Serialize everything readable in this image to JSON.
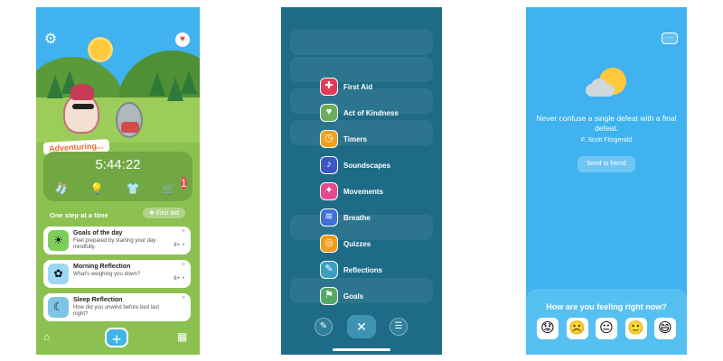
{
  "screen1": {
    "adventuring_label": "Adventuring...",
    "timer": "5:44:22",
    "cart_count": "1",
    "section_title": "One step at a time",
    "first_aid_label": "First aid",
    "cards": [
      {
        "title": "Goals of the day",
        "desc": "Feel prepared by starting your day mindfully.",
        "points": "8+ ⚡",
        "icon": "sun-icon"
      },
      {
        "title": "Morning Reflection",
        "desc": "What's weighing you down?",
        "points": "6+ ⚡",
        "icon": "flower-icon"
      },
      {
        "title": "Sleep Reflection",
        "desc": "How did you unwind before bed last night?",
        "points": "",
        "icon": "sleep-face-icon"
      }
    ],
    "close_glyph": "×",
    "plus_glyph": "+"
  },
  "screen2": {
    "menu": [
      {
        "label": "First Aid",
        "color": "#e43a57",
        "glyph": "✚",
        "icon": "first-aid-icon"
      },
      {
        "label": "Act of Kindness",
        "color": "#6aae5a",
        "glyph": "♥",
        "icon": "kindness-icon"
      },
      {
        "label": "Timers",
        "color": "#f0a020",
        "glyph": "◷",
        "icon": "timer-icon"
      },
      {
        "label": "Soundscapes",
        "color": "#3a56c8",
        "glyph": "♪",
        "icon": "music-note-icon"
      },
      {
        "label": "Movements",
        "color": "#e44b8f",
        "glyph": "✦",
        "icon": "movement-icon"
      },
      {
        "label": "Breathe",
        "color": "#3f6fd8",
        "glyph": "≋",
        "icon": "breathe-icon"
      },
      {
        "label": "Quizzes",
        "color": "#f29a1a",
        "glyph": "◎",
        "icon": "quiz-icon"
      },
      {
        "label": "Reflections",
        "color": "#3aa0c0",
        "glyph": "✎",
        "icon": "reflection-icon"
      },
      {
        "label": "Goals",
        "color": "#56a86a",
        "glyph": "⚑",
        "icon": "goals-icon"
      }
    ],
    "close_glyph": "✕"
  },
  "screen3": {
    "more_glyph": "···",
    "quote": "Never confuse a single defeat with a final defeat.",
    "author": "F. Scott Fitzgerald",
    "send_label": "Send to friend",
    "feel_question": "How are you feeling right now?",
    "faces": [
      "😟",
      "☹️",
      "😐",
      "🙂",
      "😄"
    ]
  }
}
